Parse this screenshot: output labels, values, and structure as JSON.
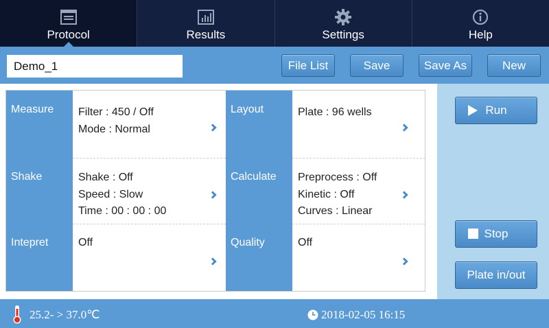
{
  "nav": {
    "tabs": [
      {
        "label": "Protocol",
        "icon": "protocol-icon",
        "active": true
      },
      {
        "label": "Results",
        "icon": "chart-icon",
        "active": false
      },
      {
        "label": "Settings",
        "icon": "gear-icon",
        "active": false
      },
      {
        "label": "Help",
        "icon": "info-icon",
        "active": false
      }
    ]
  },
  "toolbar": {
    "protocol_name": "Demo_1",
    "file_list_label": "File List",
    "save_label": "Save",
    "save_as_label": "Save As",
    "new_label": "New"
  },
  "sections": {
    "measure": {
      "label": "Measure",
      "lines": [
        "Filter :  450 / Off",
        "Mode : Normal"
      ]
    },
    "layout": {
      "label": "Layout",
      "lines": [
        "Plate :   96 wells"
      ]
    },
    "shake": {
      "label": "Shake",
      "lines": [
        "Shake : Off",
        "Speed : Slow",
        "Time :  00 : 00 : 00"
      ]
    },
    "calculate": {
      "label": "Calculate",
      "lines": [
        "Preprocess : Off",
        "Kinetic : Off",
        "Curves : Linear"
      ]
    },
    "interpret": {
      "label": "Intepret",
      "lines": [
        "Off"
      ]
    },
    "quality": {
      "label": "Quality",
      "lines": [
        "Off"
      ]
    }
  },
  "actions": {
    "run_label": "Run",
    "stop_label": "Stop",
    "plate_label": "Plate in/out"
  },
  "status": {
    "temperature": "25.2- > 37.0℃",
    "datetime": "2018-02-05 16:15",
    "thermometer_icon": "thermometer-icon",
    "clock_icon": "clock-icon"
  },
  "colors": {
    "nav_bg": "#13203f",
    "accent": "#5b9bd5",
    "panel_bg": "#b2d6ee",
    "thermometer": "#e0311f"
  }
}
